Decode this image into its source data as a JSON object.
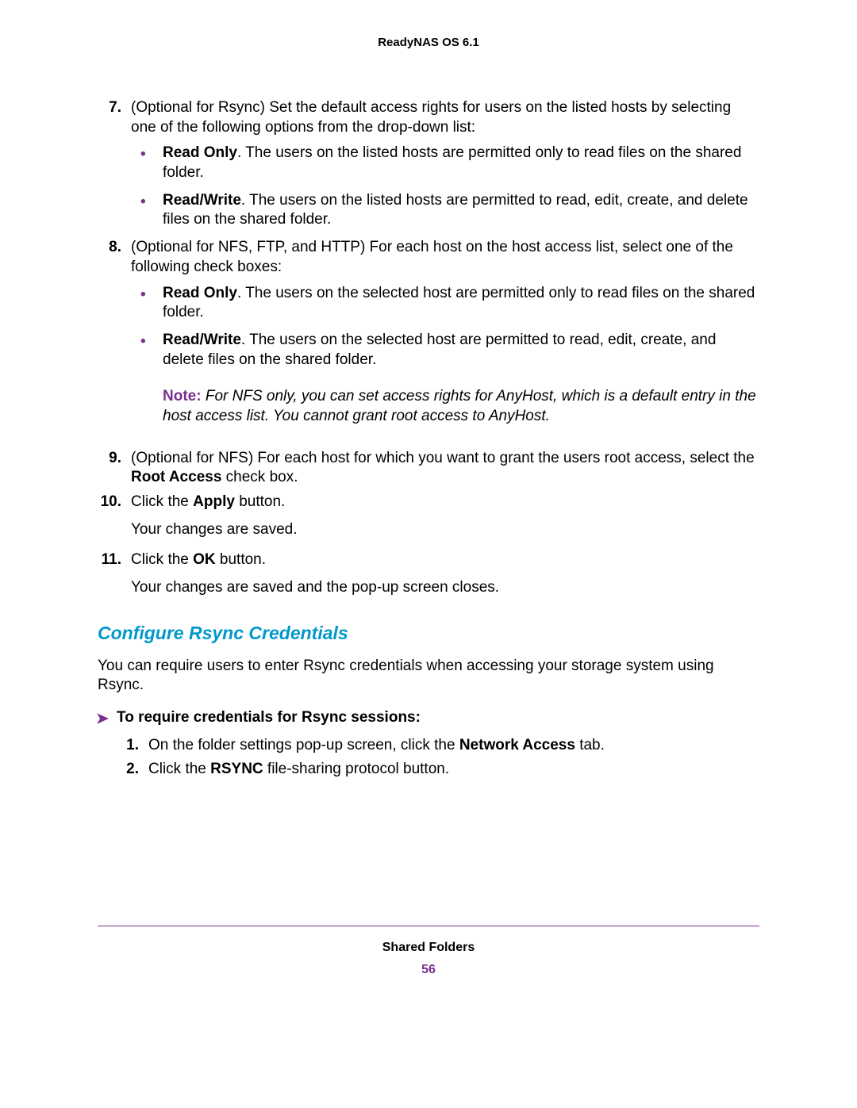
{
  "header": {
    "title": "ReadyNAS OS 6.1"
  },
  "steps": {
    "s7": {
      "num": "7.",
      "text_a": "(Optional for Rsync) Set the default access rights for users on the listed hosts by selecting one of the following options from the drop-down list:",
      "b1_label": "Read Only",
      "b1_rest": ". The users on the listed hosts are permitted only to read files on the shared folder.",
      "b2_label": "Read/Write",
      "b2_rest": ". The users on the listed hosts are permitted to read, edit, create, and delete files on the shared folder."
    },
    "s8": {
      "num": "8.",
      "text_a": "(Optional for NFS, FTP, and HTTP) For each host on the host access list, select one of the following check boxes:",
      "b1_label": "Read Only",
      "b1_rest": ". The users on the selected host are permitted only to read files on the shared folder.",
      "b2_label": "Read/Write",
      "b2_rest": ". The users on the selected host are permitted to read, edit, create, and delete files on the shared folder."
    },
    "note": {
      "label": "Note:",
      "text": "For NFS only, you can set access rights for AnyHost, which is a default entry in the host access list. You cannot grant root access to AnyHost."
    },
    "s9": {
      "num": "9.",
      "pre": "(Optional for NFS) For each host for which you want to grant the users root access, select the ",
      "bold": "Root Access",
      "post": " check box."
    },
    "s10": {
      "num": "10.",
      "pre": "Click the ",
      "bold": "Apply",
      "post": " button.",
      "result": "Your changes are saved."
    },
    "s11": {
      "num": "11.",
      "pre": "Click the ",
      "bold": "OK",
      "post": " button.",
      "result": "Your changes are saved and the pop-up screen closes."
    }
  },
  "section": {
    "heading": "Configure Rsync Credentials",
    "intro": "You can require users to enter Rsync credentials when accessing your storage system using Rsync.",
    "instr_head": "To require credentials for Rsync sessions:",
    "arrow": "➤",
    "i1": {
      "num": "1.",
      "pre": "On the folder settings pop-up screen, click the ",
      "bold": "Network Access",
      "post": " tab."
    },
    "i2": {
      "num": "2.",
      "pre": "Click the ",
      "bold": "RSYNC",
      "post": " file-sharing protocol button."
    }
  },
  "footer": {
    "section": "Shared Folders",
    "page": "56"
  },
  "bullet": "•"
}
